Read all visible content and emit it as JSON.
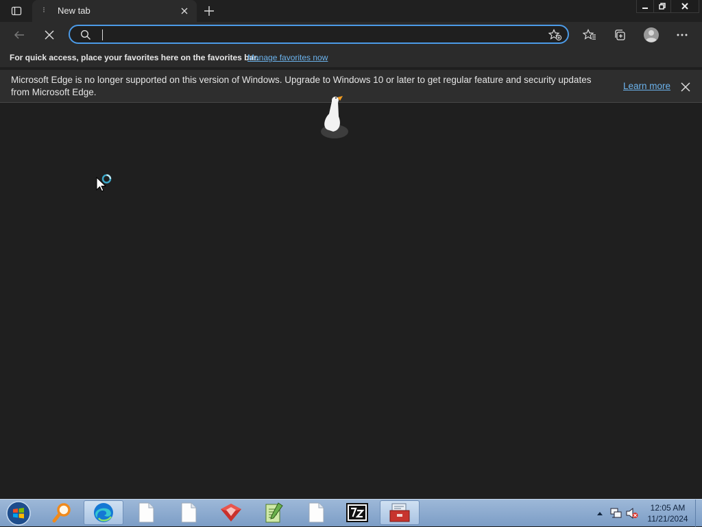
{
  "tab": {
    "title": "New tab"
  },
  "omnibox": {
    "value": "",
    "placeholder": ""
  },
  "favorites_bar": {
    "text": "For quick access, place your favorites here on the favorites bar.",
    "link": "Manage favorites now"
  },
  "infobar": {
    "message": "Microsoft Edge is no longer supported on this version of Windows. Upgrade to Windows 10 or later to get regular feature and security updates from Microsoft Edge.",
    "learn_more": "Learn more"
  },
  "taskbar": {
    "pinned": [
      "search-app",
      "edge",
      "file",
      "file",
      "shield-app",
      "notepad-app",
      "file",
      "7zip",
      "toolbox-app"
    ]
  },
  "clock": {
    "time": "12:05 AM",
    "date": "11/21/2024"
  },
  "colors": {
    "accent": "#4c9be8",
    "link": "#6cb4ee",
    "background": "#1f1f1f"
  }
}
